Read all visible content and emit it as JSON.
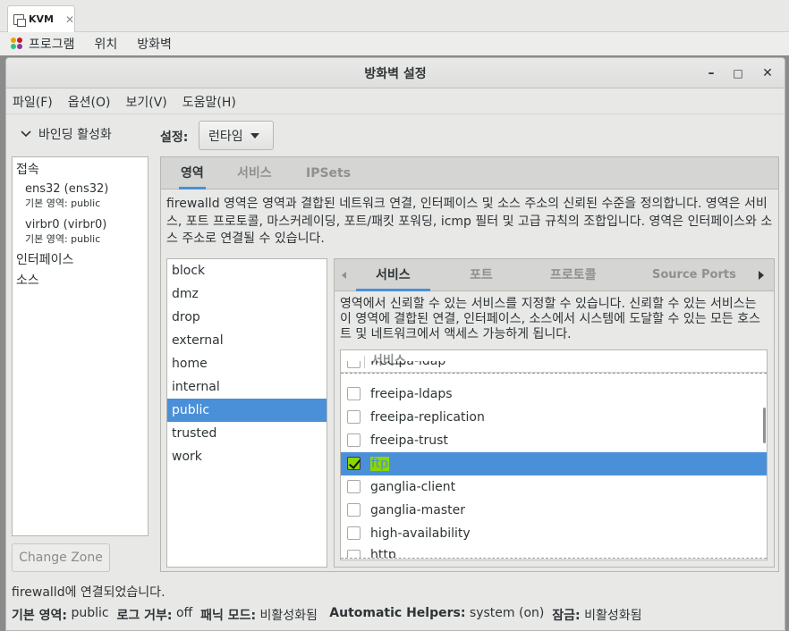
{
  "host": {
    "tab_title": "KVM",
    "tab_close": "✕",
    "menu": [
      "프로그램",
      "위치",
      "방화벽"
    ]
  },
  "window": {
    "title": "방화벽 설정",
    "min": "–",
    "max": "□",
    "close": "✕"
  },
  "menubar": [
    "파일(F)",
    "옵션(O)",
    "보기(V)",
    "도움말(H)"
  ],
  "sidebar": {
    "binding_label": "바인딩 활성화",
    "connections_header": "접속",
    "connections": [
      {
        "name": "ens32 (ens32)",
        "zone": "기본 영역: public"
      },
      {
        "name": "virbr0 (virbr0)",
        "zone": "기본 영역: public"
      }
    ],
    "interfaces_header": "인터페이스",
    "sources_header": "소스",
    "change_zone": "Change Zone"
  },
  "config": {
    "label": "설정:",
    "value": "런타임"
  },
  "main_tabs": [
    "영역",
    "서비스",
    "IPSets"
  ],
  "zone_description": "firewalld 영역은 영역과 결합된 네트워크 연결, 인터페이스 및 소스 주소의 신뢰된 수준을 정의합니다. 영역은 서비스, 포트 프로토콜, 마스커레이딩, 포트/패킷 포워딩, icmp 필터 및 고급 규칙의 조합입니다. 영역은 인터페이스와 소스 주소로 연결될 수 있습니다.",
  "zones": [
    "block",
    "dmz",
    "drop",
    "external",
    "home",
    "internal",
    "public",
    "trusted",
    "work"
  ],
  "selected_zone": "public",
  "inner_tabs": [
    "서비스",
    "포트",
    "프로토콜",
    "Source Ports"
  ],
  "service_description": "영역에서 신뢰할 수 있는 서비스를 지정할 수 있습니다. 신뢰할 수 있는 서비스는 이 영역에 결합된 연결, 인터페이스, 소스에서 시스템에 도달할 수 있는 모든 호스트 및 네트워크에서 액세스 가능하게 됩니다.",
  "services_header": "서비스",
  "services": [
    {
      "name": "freeipa-ldap",
      "checked": false
    },
    {
      "name": "freeipa-ldaps",
      "checked": false
    },
    {
      "name": "freeipa-replication",
      "checked": false
    },
    {
      "name": "freeipa-trust",
      "checked": false
    },
    {
      "name": "ftp",
      "checked": true
    },
    {
      "name": "ganglia-client",
      "checked": false
    },
    {
      "name": "ganglia-master",
      "checked": false
    },
    {
      "name": "high-availability",
      "checked": false
    },
    {
      "name": "http",
      "checked": false
    }
  ],
  "status": {
    "connection": "firewalld에 연결되었습니다.",
    "default_zone_label": "기본 영역:",
    "default_zone": "public",
    "log_denied_label": "로그 거부:",
    "log_denied": "off",
    "panic_label": "패닉 모드:",
    "panic": "비활성화됨",
    "helpers_label": "Automatic Helpers:",
    "helpers": "system (on)",
    "lockdown_label": "잠금:",
    "lockdown": "비활성화됨"
  }
}
